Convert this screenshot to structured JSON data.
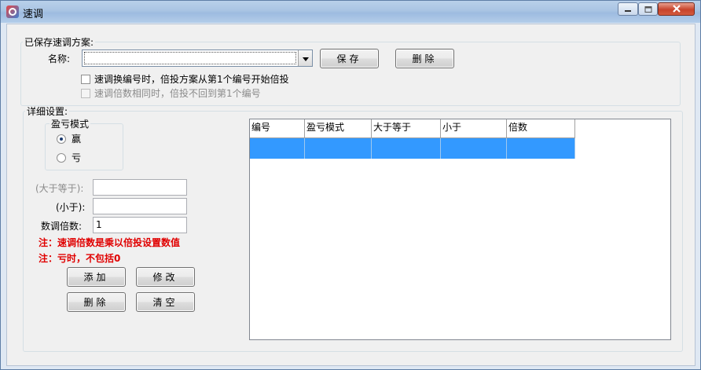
{
  "window": {
    "title": "速调",
    "controls": {
      "minimize": "minimize-icon",
      "maximize": "maximize-icon",
      "close": "close-icon"
    }
  },
  "saved": {
    "group_label": "已保存速调方案:",
    "name_label": "名称:",
    "name_value": "",
    "save_button": "保存",
    "delete_button": "删除",
    "checkbox1": {
      "label": "速调换编号时，倍投方案从第1个编号开始倍投",
      "checked": false
    },
    "checkbox2": {
      "label": "速调倍数相同时，倍投不回到第1个编号",
      "checked": false,
      "disabled": true
    }
  },
  "details": {
    "group_label": "详细设置:",
    "mode_group_label": "盈亏模式",
    "mode_options": [
      {
        "label": "赢",
        "selected": true
      },
      {
        "label": "亏",
        "selected": false
      }
    ],
    "gte_label": "(大于等于):",
    "gte_value": "",
    "lt_label": "(小于):",
    "lt_value": "",
    "multiplier_label": "数调倍数:",
    "multiplier_value": "1",
    "note1": "注：速调倍数是乘以倍投设置数值",
    "note2": "注：亏时，不包括0",
    "buttons": {
      "add": "添加",
      "modify": "修改",
      "delete": "删除",
      "clear": "清空"
    }
  },
  "table": {
    "columns": [
      "编号",
      "盈亏模式",
      "大于等于",
      "小于",
      "倍数"
    ],
    "rows": [
      [
        "",
        "",
        "",
        "",
        ""
      ]
    ]
  },
  "colors": {
    "selection": "#3399ff",
    "note_red": "#e00000"
  }
}
